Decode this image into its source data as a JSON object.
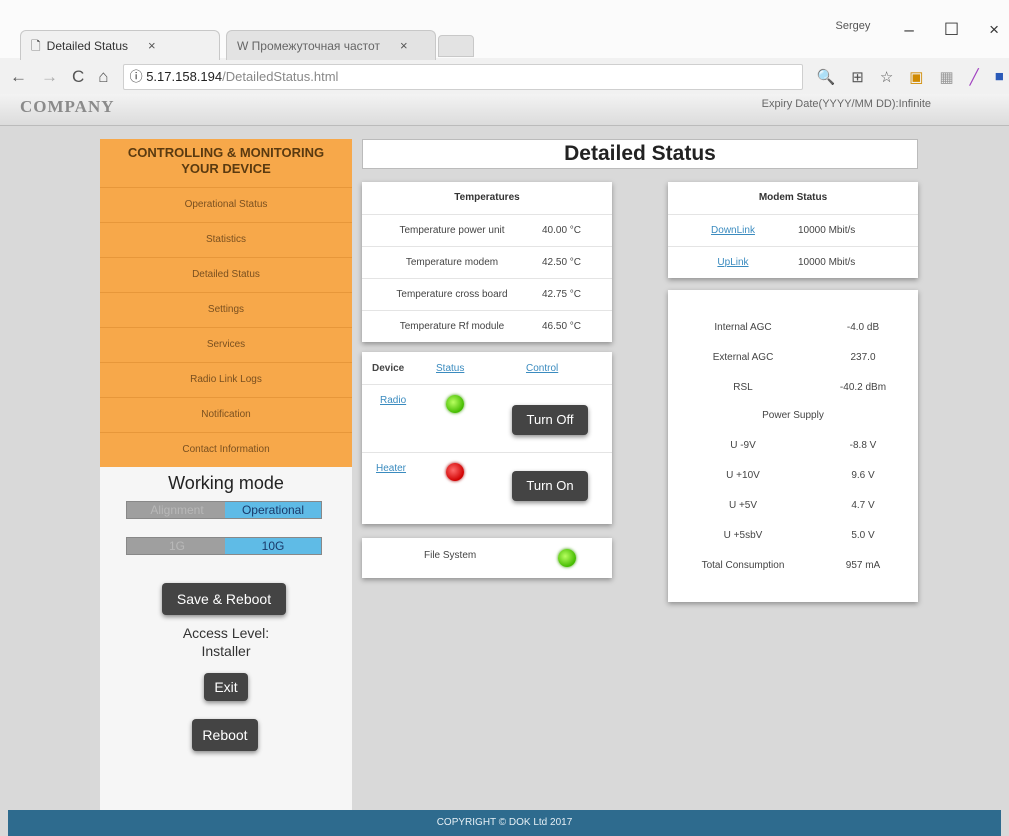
{
  "browser": {
    "tabs": [
      {
        "title": "Detailed Status",
        "close": "×"
      },
      {
        "title": "W Промежуточная частот",
        "close": "×"
      }
    ],
    "user": "Sergey",
    "win_min": "–",
    "win_max": "☐",
    "win_close": "×",
    "nav_back": "←",
    "nav_forward": "→",
    "nav_reload": "C",
    "nav_home": "⌂",
    "url_secure": "ⓘ",
    "url_host": "5.17.158.194",
    "url_path": "/DetailedStatus.html"
  },
  "header": {
    "company": "COMPANY",
    "expiry": "Expiry Date(YYYY/MM DD):Infinite"
  },
  "sidebar": {
    "title_line1": "CONTROLLING & MONITORING",
    "title_line2": "YOUR DEVICE",
    "items": [
      {
        "label": "Operational Status"
      },
      {
        "label": "Statistics"
      },
      {
        "label": "Detailed Status"
      },
      {
        "label": "Settings"
      },
      {
        "label": "Services"
      },
      {
        "label": "Radio Link Logs"
      },
      {
        "label": "Notification"
      },
      {
        "label": "Contact Information"
      }
    ],
    "working_mode": "Working mode",
    "mode_toggle": {
      "off": "Alignment",
      "on": "Operational"
    },
    "speed_toggle": {
      "off": "1G",
      "on": "10G"
    },
    "save_reboot": "Save & Reboot",
    "access_level": "Access Level:",
    "access_value": "Installer",
    "exit": "Exit",
    "reboot": "Reboot"
  },
  "main": {
    "title": "Detailed Status",
    "temperatures": {
      "heading": "Temperatures",
      "rows": [
        {
          "label": "Temperature power unit",
          "value": "40.00 °C"
        },
        {
          "label": "Temperature modem",
          "value": "42.50 °C"
        },
        {
          "label": "Temperature cross board",
          "value": "42.75 °C"
        },
        {
          "label": "Temperature Rf module",
          "value": "46.50 °C"
        }
      ]
    },
    "devices": {
      "col_device": "Device",
      "col_status": "Status",
      "col_control": "Control",
      "rows": [
        {
          "name": "Radio",
          "status": "green",
          "button": "Turn Off"
        },
        {
          "name": "Heater",
          "status": "red",
          "button": "Turn On"
        }
      ]
    },
    "file_system": {
      "label": "File System",
      "status": "green"
    },
    "modem_status": {
      "heading": "Modem Status",
      "rows": [
        {
          "label": "DownLink",
          "value": "10000 Mbit/s"
        },
        {
          "label": "UpLink",
          "value": "10000 Mbit/s"
        }
      ]
    },
    "power": {
      "rows": [
        {
          "label": "Internal AGC",
          "value": "-4.0 dB"
        },
        {
          "label": "External AGC",
          "value": "237.0"
        },
        {
          "label": "RSL",
          "value": "-40.2 dBm"
        }
      ],
      "supply_heading": "Power Supply",
      "supply_rows": [
        {
          "label": "U -9V",
          "value": "-8.8 V"
        },
        {
          "label": "U +10V",
          "value": "9.6 V"
        },
        {
          "label": "U +5V",
          "value": "4.7 V"
        },
        {
          "label": "U +5sbV",
          "value": "5.0 V"
        },
        {
          "label": "Total Consumption",
          "value": "957 mA"
        }
      ]
    }
  },
  "footer": {
    "text": "COPYRIGHT © DOK Ltd 2017"
  },
  "colors": {
    "menu": "#f7a84a",
    "footer": "#2e6b8e",
    "toggle_on": "#5fbbe6",
    "led_green": "#44bb00",
    "led_red": "#d00000"
  }
}
